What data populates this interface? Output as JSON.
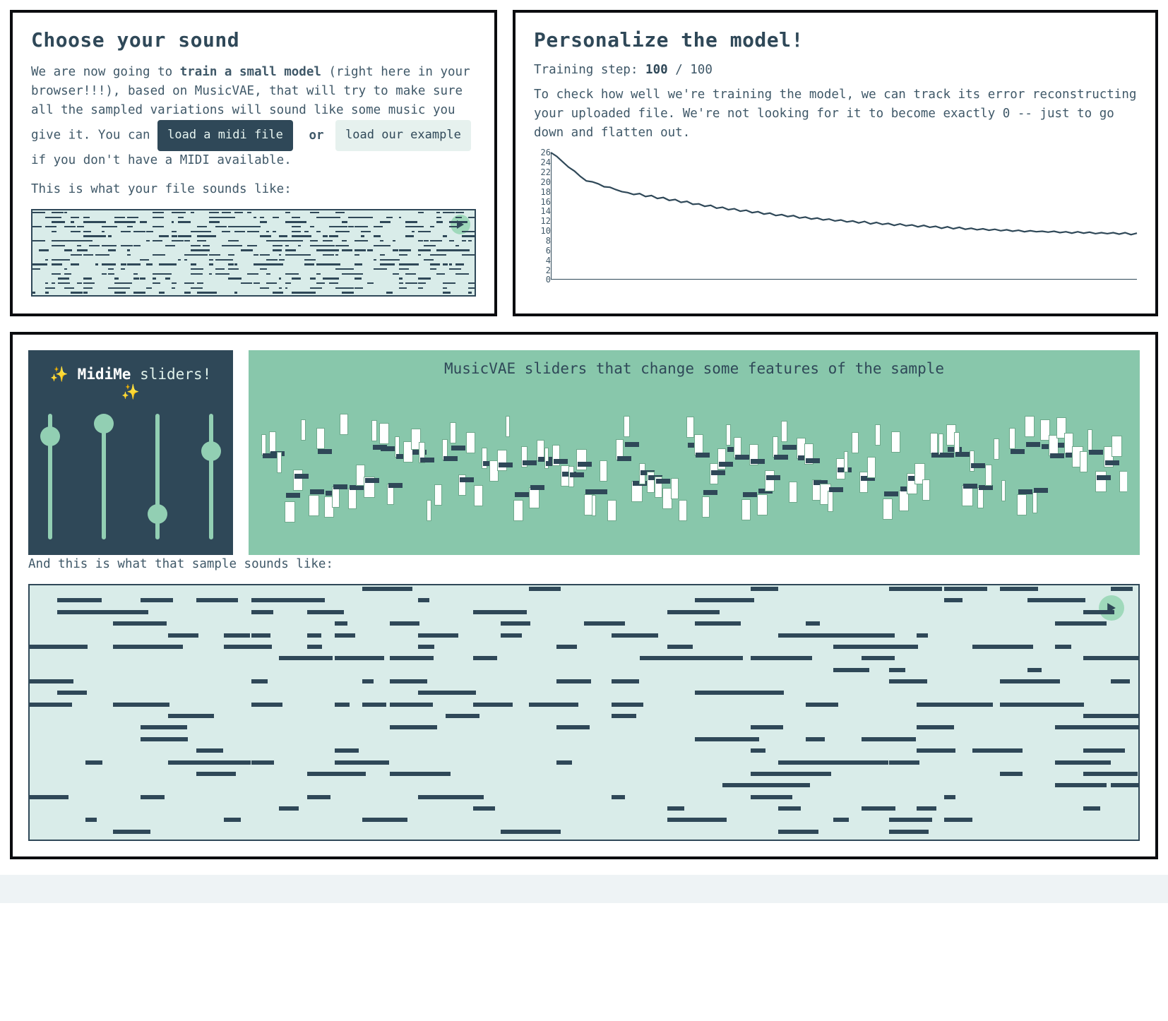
{
  "choose": {
    "heading": "Choose your sound",
    "body_pre": "We are now going to ",
    "body_bold": "train a small model",
    "body_post": " (right here in your browser!!!), based on MusicVAE, that will try to make sure all the sampled variations will sound like some music you give it. You can ",
    "btn_load_midi": "load a midi file",
    "or": "or",
    "btn_load_example": "load our example",
    "body_tail": " if you don't have a MIDI available.",
    "sounds_like": "This is what your file sounds like:"
  },
  "personalize": {
    "heading": "Personalize the model!",
    "step_label": "Training step: ",
    "step_current": "100",
    "step_sep": " / ",
    "step_total": "100",
    "body": "To check how well we're training the model, we can track its error reconstructing your uploaded file. We're not looking for it to become exactly 0 -- just to go down and flatten out."
  },
  "chart_data": {
    "type": "line",
    "title": "",
    "xlabel": "",
    "ylabel": "",
    "ylim": [
      0,
      26
    ],
    "yticks": [
      0,
      2,
      4,
      6,
      8,
      10,
      12,
      14,
      16,
      18,
      20,
      22,
      24,
      26
    ],
    "x": [
      0,
      1,
      2,
      3,
      4,
      5,
      6,
      7,
      8,
      9,
      10,
      11,
      12,
      13,
      14,
      15,
      16,
      17,
      18,
      19,
      20,
      21,
      22,
      23,
      24,
      25,
      26,
      27,
      28,
      29,
      30,
      31,
      32,
      33,
      34,
      35,
      36,
      37,
      38,
      39,
      40,
      41,
      42,
      43,
      44,
      45,
      46,
      47,
      48,
      49,
      50,
      51,
      52,
      53,
      54,
      55,
      56,
      57,
      58,
      59,
      60,
      61,
      62,
      63,
      64,
      65,
      66,
      67,
      68,
      69,
      70,
      71,
      72,
      73,
      74,
      75,
      76,
      77,
      78,
      79,
      80,
      81,
      82,
      83,
      84,
      85,
      86,
      87,
      88,
      89,
      90,
      91,
      92,
      93,
      94,
      95,
      96,
      97,
      98,
      99
    ],
    "values": [
      26,
      25.2,
      24.1,
      23.0,
      22.2,
      21.1,
      20.2,
      20.0,
      19.6,
      19.0,
      18.9,
      18.4,
      18.0,
      17.8,
      17.4,
      17.6,
      17.0,
      17.2,
      16.6,
      16.8,
      16.2,
      16.4,
      15.8,
      16.0,
      15.4,
      15.5,
      15.0,
      15.2,
      14.6,
      14.8,
      14.3,
      14.5,
      14.0,
      14.2,
      13.7,
      13.9,
      13.4,
      13.6,
      13.1,
      13.3,
      12.9,
      13.1,
      12.6,
      12.8,
      12.4,
      12.6,
      12.2,
      12.4,
      12.0,
      12.2,
      11.8,
      12.0,
      11.6,
      11.9,
      11.4,
      11.7,
      11.3,
      11.5,
      11.1,
      11.4,
      11.0,
      11.2,
      10.8,
      11.1,
      10.7,
      10.9,
      10.5,
      10.8,
      10.4,
      10.7,
      10.3,
      10.5,
      10.2,
      10.4,
      10.1,
      10.3,
      10.0,
      10.2,
      9.9,
      10.1,
      9.8,
      10.0,
      9.8,
      9.9,
      9.7,
      9.9,
      9.6,
      9.8,
      9.5,
      9.8,
      9.5,
      9.7,
      9.4,
      9.6,
      9.4,
      9.6,
      9.3,
      9.6,
      9.2,
      9.5
    ]
  },
  "midime": {
    "title_pre": "✨",
    "title_bold": "MidiMe",
    "title_post": " sliders!",
    "title_suf": "✨",
    "slider_positions_pct": [
      18,
      8,
      80,
      30
    ]
  },
  "mvae": {
    "title": "MusicVAE sliders that change some features of the sample"
  },
  "sample": {
    "label": "And this is what that sample sounds like:"
  },
  "icons": {
    "play": "play"
  },
  "colors": {
    "ink": "#2f4858",
    "mint": "#d9ece9",
    "mint_deep": "#88c7ab"
  }
}
